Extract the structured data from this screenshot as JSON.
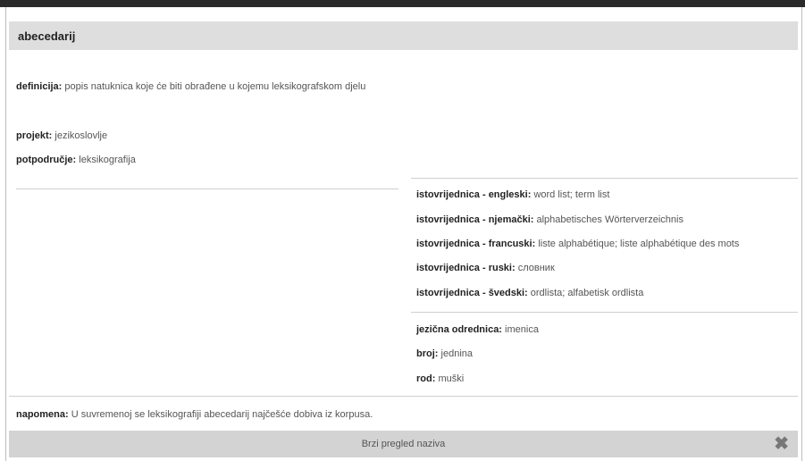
{
  "title": "abecedarij",
  "definition": {
    "label": "definicija:",
    "value": "popis natuknica koje će biti obrađene u kojemu leksikografskom djelu"
  },
  "project": {
    "label": "projekt:",
    "value": "jezikoslovlje"
  },
  "subfield": {
    "label": "potpodručje:",
    "value": "leksikografija"
  },
  "equivalents": [
    {
      "label": "istovrijednica - engleski:",
      "value": "word list; term list"
    },
    {
      "label": "istovrijednica - njemački:",
      "value": "alphabetisches Wörterverzeichnis"
    },
    {
      "label": "istovrijednica - francuski:",
      "value": "liste alphabétique; liste alphabétique des mots"
    },
    {
      "label": "istovrijednica - ruski:",
      "value": "словник"
    },
    {
      "label": "istovrijednica - švedski:",
      "value": "ordlista; alfabetisk ordlista"
    }
  ],
  "grammar": [
    {
      "label": "jezična odrednica:",
      "value": "imenica"
    },
    {
      "label": "broj:",
      "value": "jednina"
    },
    {
      "label": "rod:",
      "value": "muški"
    }
  ],
  "note": {
    "label": "napomena:",
    "value": "U suvremenoj se leksikografiji abecedarij najčešće dobiva iz korpusa."
  },
  "footer": {
    "label": "Brzi pregled naziva"
  },
  "icons": {
    "close": "close-icon"
  }
}
